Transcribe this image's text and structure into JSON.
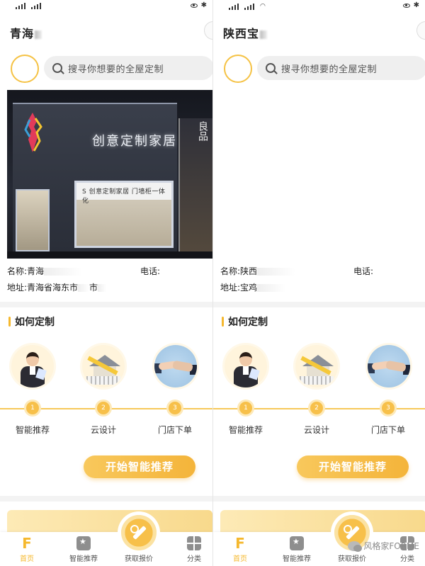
{
  "left": {
    "city": "青海",
    "search_placeholder": "搜寻你想要的全屋定制",
    "store_sign": "创意定制家居",
    "store_window_text": "S 创意定制家居  门墙柜一体化",
    "store_wing_text": "良品",
    "name_label": "名称:青海",
    "phone_label": "电话:",
    "address_label": "地址:青海省海东市",
    "address_tail": "市"
  },
  "right": {
    "city": "陕西宝",
    "search_placeholder": "搜寻你想要的全屋定制",
    "name_label": "名称:陕西",
    "phone_label": "电话:",
    "address_label": "地址:宝鸡"
  },
  "section": {
    "title": "如何定制",
    "steps": [
      {
        "num": "1",
        "label": "智能推荐",
        "icon": "consultant-icon"
      },
      {
        "num": "2",
        "label": "云设计",
        "icon": "house-design-icon"
      },
      {
        "num": "3",
        "label": "门店下单",
        "icon": "handshake-icon"
      }
    ],
    "cta": "开始智能推荐"
  },
  "nav": {
    "home": "首页",
    "cases": "智能推荐",
    "quote": "获取报价",
    "category": "分类"
  },
  "watermark": "风格家FORME",
  "colors": {
    "accent": "#f5b82e",
    "accent_light": "#fde9b8"
  }
}
